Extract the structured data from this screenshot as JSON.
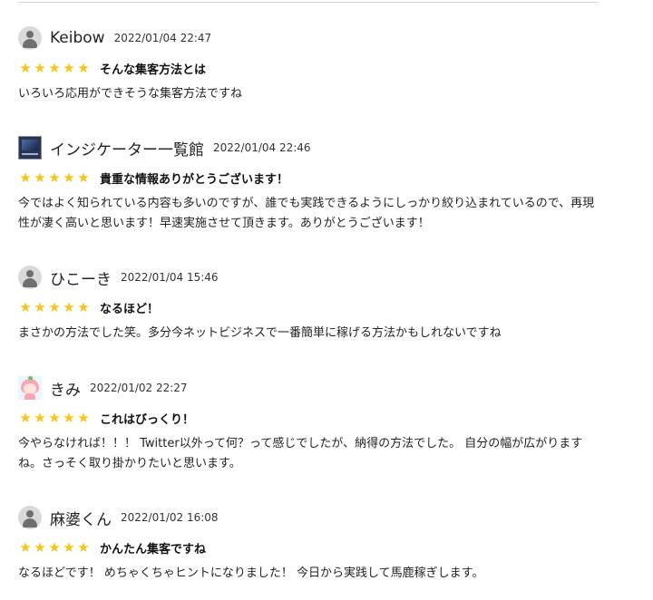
{
  "reviews": [
    {
      "author": "Keibow",
      "date": "2022/01/04 22:47",
      "avatar": "default-user-icon",
      "rating": 5,
      "title": "そんな集客方法とは",
      "body": "いろいろ応用ができそうな集客方法ですね"
    },
    {
      "author": "インジケーター一覧館",
      "date": "2022/01/04 22:46",
      "avatar": "indicator-thumbnail-icon",
      "rating": 5,
      "title": "貴重な情報ありがとうございます！",
      "body": "今ではよく知られている内容も多いのですが、誰でも実践できるようにしっかり絞り込まれているので、再現性が凄く高いと思います！早速実施させて頂きます。ありがとうございます！"
    },
    {
      "author": "ひこーき",
      "date": "2022/01/04 15:46",
      "avatar": "default-user-icon",
      "rating": 5,
      "title": "なるほど！",
      "body": "まさかの方法でした笑。多分今ネットビジネスで一番簡単に稼げる方法かもしれないですね"
    },
    {
      "author": "きみ",
      "date": "2022/01/02 22:27",
      "avatar": "peach-girl-icon",
      "rating": 5,
      "title": "これはびっくり！",
      "body": "今やらなければ！！！ Twitter以外って何？って感じでしたが、納得の方法でした。 自分の幅が広がりますね。さっそく取り掛かりたいと思います。"
    },
    {
      "author": "麻婆くん",
      "date": "2022/01/02 16:08",
      "avatar": "default-user-icon",
      "rating": 5,
      "title": "かんたん集客ですね",
      "body": "なるほどです！ めちゃくちゃヒントになりました！ 今日から実践して馬鹿稼ぎします。"
    }
  ],
  "colors": {
    "star": "#f5c518",
    "divider": "#d4d4d4",
    "text": "#222222"
  }
}
